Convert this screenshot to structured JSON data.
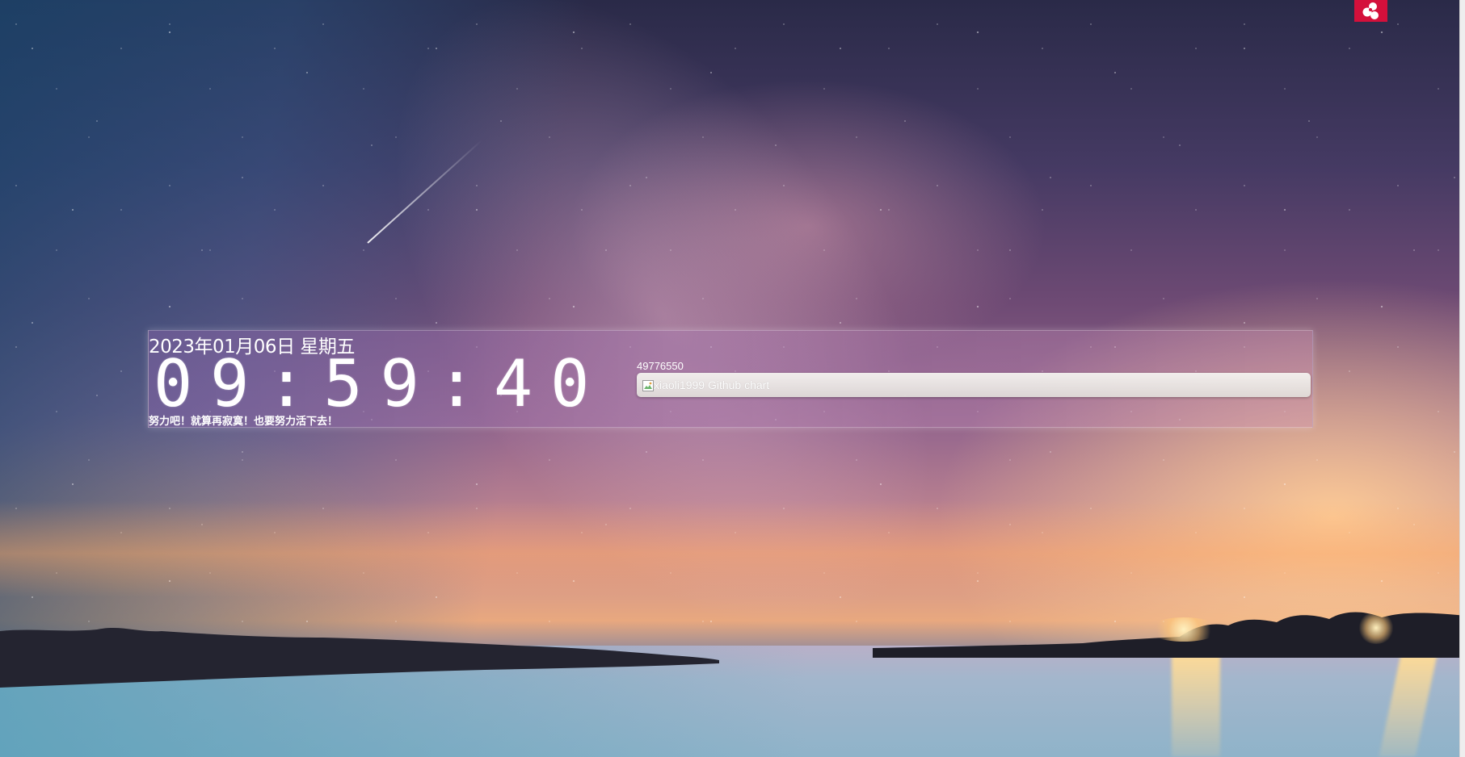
{
  "clock": {
    "date": "2023年01月06日 星期五",
    "time": "09:59:40",
    "motto": "努力吧！就算再寂寞！也要努力活下去！"
  },
  "github": {
    "counter": "49776550",
    "chart_alt": "xiaoli1999 Github chart"
  },
  "badge": {
    "icon": "cluster-logo-icon",
    "color": "#d4103b"
  },
  "icons": {
    "broken_image": "broken-image-icon"
  }
}
